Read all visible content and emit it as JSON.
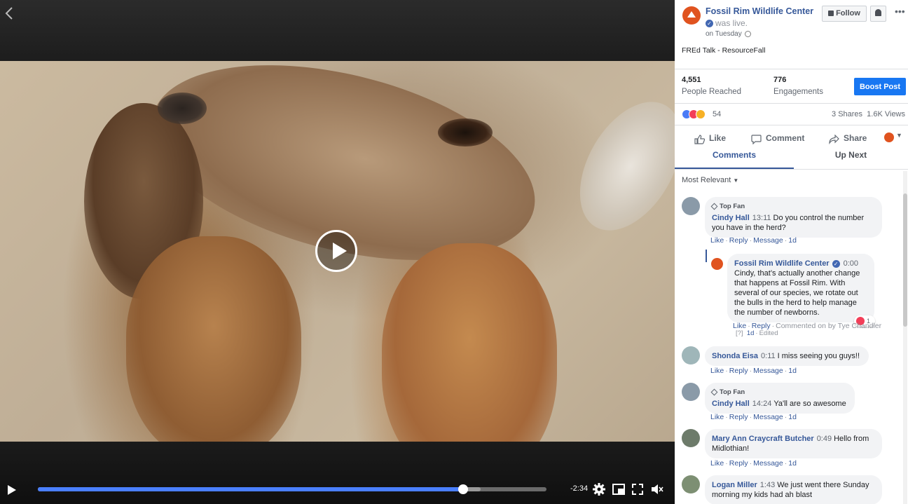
{
  "video": {
    "time_remaining": "-2:34",
    "progress_fraction": 0.836,
    "buffered_fraction": 0.87
  },
  "post": {
    "page_name": "Fossil Rim Wildlife Center",
    "was_live": "was live.",
    "posted": "on Tuesday",
    "follow_label": "Follow",
    "text": "FREd Talk - ResourceFall"
  },
  "stats": {
    "reached_num": "4,551",
    "reached_label": "People Reached",
    "engagements_num": "776",
    "engagements_label": "Engagements",
    "boost_label": "Boost Post",
    "reaction_count": "54",
    "shares": "3 Shares",
    "views": "1.6K Views"
  },
  "actions": {
    "like": "Like",
    "comment": "Comment",
    "share": "Share"
  },
  "tabs": {
    "comments": "Comments",
    "up_next": "Up Next"
  },
  "sort_label": "Most Relevant",
  "comments": [
    {
      "badge": "Top Fan",
      "author": "Cindy Hall",
      "stamp": "13:11",
      "text": "Do you control the number you have in the herd?",
      "like": "Like",
      "reply": "Reply",
      "message": "Message",
      "age": "1d"
    },
    {
      "author": "Fossil Rim Wildlife Center",
      "stamp": "0:00",
      "text": "Cindy, that’s actually another change that happens at Fossil Rim. With several of our species, we rotate out the bulls in the herd to help manage the number of newborns.",
      "heart_count": "1",
      "like": "Like",
      "reply": "Reply",
      "commented_on": "Commented on by Tye Chandler",
      "help": "[?]",
      "age": "1d",
      "edited": "Edited"
    },
    {
      "author": "Shonda Eisa",
      "stamp": "0:11",
      "text": "I miss seeing you guys!!",
      "like": "Like",
      "reply": "Reply",
      "message": "Message",
      "age": "1d"
    },
    {
      "badge": "Top Fan",
      "author": "Cindy Hall",
      "stamp": "14:24",
      "text": "Ya'll are so awesome",
      "like": "Like",
      "reply": "Reply",
      "message": "Message",
      "age": "1d"
    },
    {
      "author": "Mary Ann Craycraft Butcher",
      "stamp": "0:49",
      "text": "Hello from Midlothian!",
      "like": "Like",
      "reply": "Reply",
      "message": "Message",
      "age": "1d"
    },
    {
      "author": "Logan Miller",
      "stamp": "1:43",
      "text": "We just went there Sunday morning my kids had ah blast"
    }
  ],
  "colors": {
    "link_blue": "#365899",
    "boost_blue": "#1877f2",
    "progress_blue": "#4a7fff",
    "brand_orange": "#e0531f"
  },
  "icons": [
    "back-arrow-icon",
    "play-icon",
    "gear-icon",
    "picture-in-picture-icon",
    "fullscreen-icon",
    "volume-icon",
    "bell-icon",
    "more-icon",
    "like-icon",
    "comment-icon",
    "share-icon",
    "globe-icon",
    "verified-icon",
    "top-fan-icon",
    "heart-icon"
  ]
}
